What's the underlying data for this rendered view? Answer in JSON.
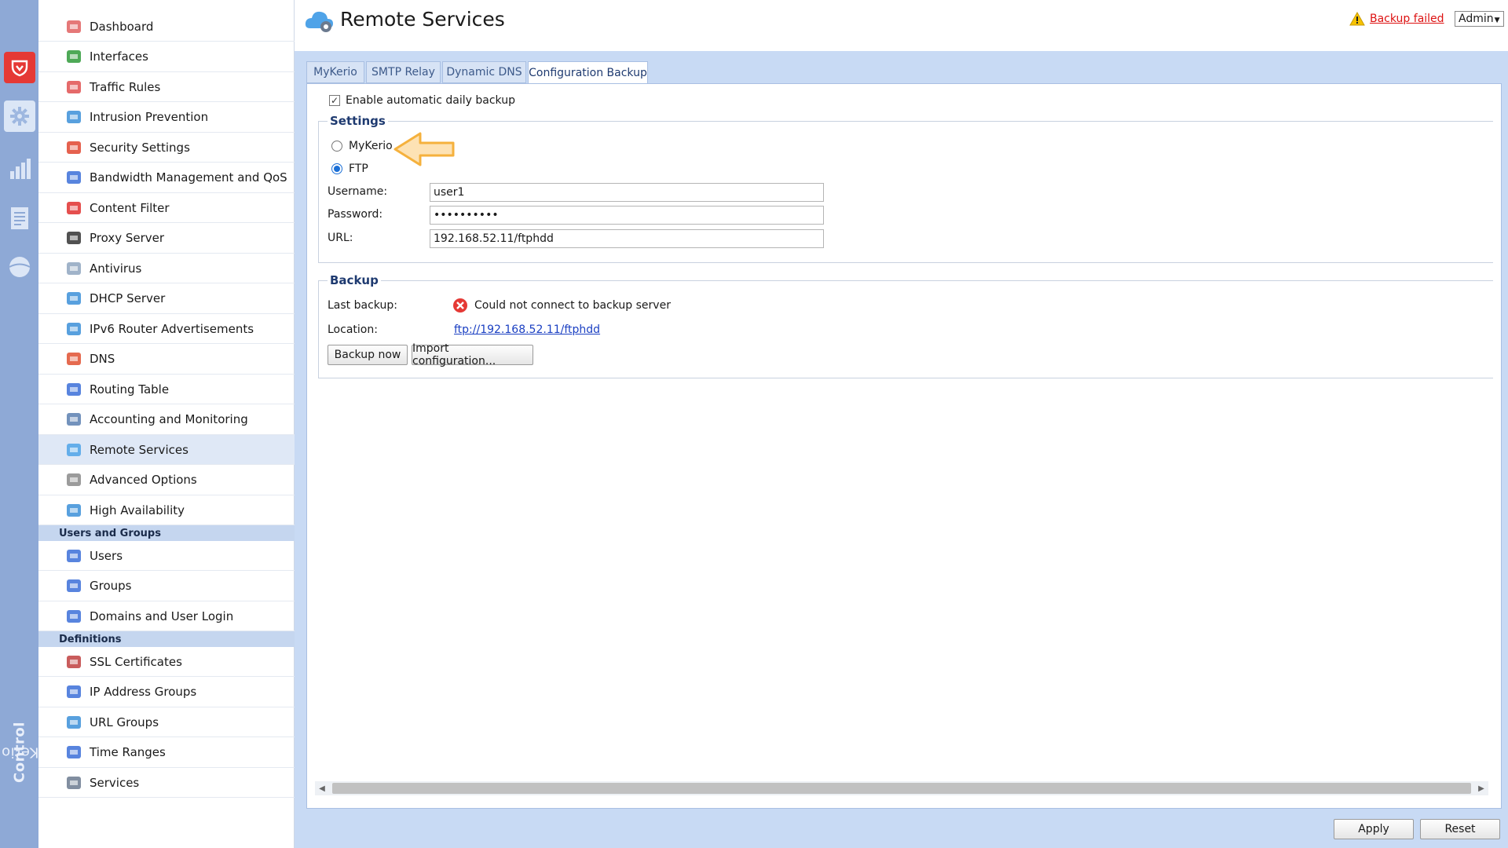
{
  "rail": {
    "brand_light": "Kerio",
    "brand_bold": "Control",
    "icons": [
      "shield-logo-icon",
      "gear-icon",
      "bar-chart-icon",
      "logs-icon",
      "status-globe-icon"
    ]
  },
  "sidebar": {
    "items": [
      {
        "label": "Dashboard",
        "icon": "dashboard-icon"
      },
      {
        "label": "Interfaces",
        "icon": "interfaces-icon"
      },
      {
        "label": "Traffic Rules",
        "icon": "traffic-rules-icon"
      },
      {
        "label": "Intrusion Prevention",
        "icon": "shield-icon"
      },
      {
        "label": "Security Settings",
        "icon": "security-hand-icon"
      },
      {
        "label": "Bandwidth Management and QoS",
        "icon": "bandwidth-icon"
      },
      {
        "label": "Content Filter",
        "icon": "filter-icon"
      },
      {
        "label": "Proxy Server",
        "icon": "proxy-icon"
      },
      {
        "label": "Antivirus",
        "icon": "antivirus-icon"
      },
      {
        "label": "DHCP Server",
        "icon": "dhcp-icon"
      },
      {
        "label": "IPv6 Router Advertisements",
        "icon": "ipv6-icon"
      },
      {
        "label": "DNS",
        "icon": "dns-icon"
      },
      {
        "label": "Routing Table",
        "icon": "routing-icon"
      },
      {
        "label": "Accounting and Monitoring",
        "icon": "accounting-icon"
      },
      {
        "label": "Remote Services",
        "icon": "cloud-icon"
      },
      {
        "label": "Advanced Options",
        "icon": "tools-icon"
      },
      {
        "label": "High Availability",
        "icon": "high-availability-icon"
      }
    ],
    "users_header": "Users and Groups",
    "users_items": [
      {
        "label": "Users",
        "icon": "user-icon"
      },
      {
        "label": "Groups",
        "icon": "group-icon"
      },
      {
        "label": "Domains and User Login",
        "icon": "domain-icon"
      }
    ],
    "definitions_header": "Definitions",
    "definitions_items": [
      {
        "label": "SSL Certificates",
        "icon": "certificate-icon"
      },
      {
        "label": "IP Address Groups",
        "icon": "ip-group-icon"
      },
      {
        "label": "URL Groups",
        "icon": "url-group-icon"
      },
      {
        "label": "Time Ranges",
        "icon": "time-range-icon"
      },
      {
        "label": "Services",
        "icon": "services-icon"
      }
    ]
  },
  "header": {
    "title": "Remote Services",
    "backup_status": "Backup failed",
    "user_menu": "Admin"
  },
  "tabs": [
    "MyKerio",
    "SMTP Relay",
    "Dynamic DNS",
    "Configuration Backup"
  ],
  "active_tab": "Configuration Backup",
  "form": {
    "enable_label": "Enable automatic daily backup",
    "enabled": true,
    "settings_legend": "Settings",
    "radio_mykerio": "MyKerio",
    "radio_ftp": "FTP",
    "selected": "FTP",
    "username_label": "Username:",
    "username_value": "user1",
    "password_label": "Password:",
    "password_value": "••••••••••",
    "url_label": "URL:",
    "url_value": "192.168.52.11/ftphdd"
  },
  "backup": {
    "legend": "Backup",
    "last_label": "Last backup:",
    "last_value": "Could not connect to backup server",
    "location_label": "Location:",
    "location_value": "ftp://192.168.52.11/ftphdd",
    "backup_now": "Backup now",
    "import_config": "Import configuration..."
  },
  "footer": {
    "apply": "Apply",
    "reset": "Reset"
  },
  "colors": {
    "rail": "#8ea9d6",
    "content_bg": "#c8daf4",
    "accent": "#1e3a70",
    "error": "#e53935",
    "arrow": "#f5b13d"
  }
}
